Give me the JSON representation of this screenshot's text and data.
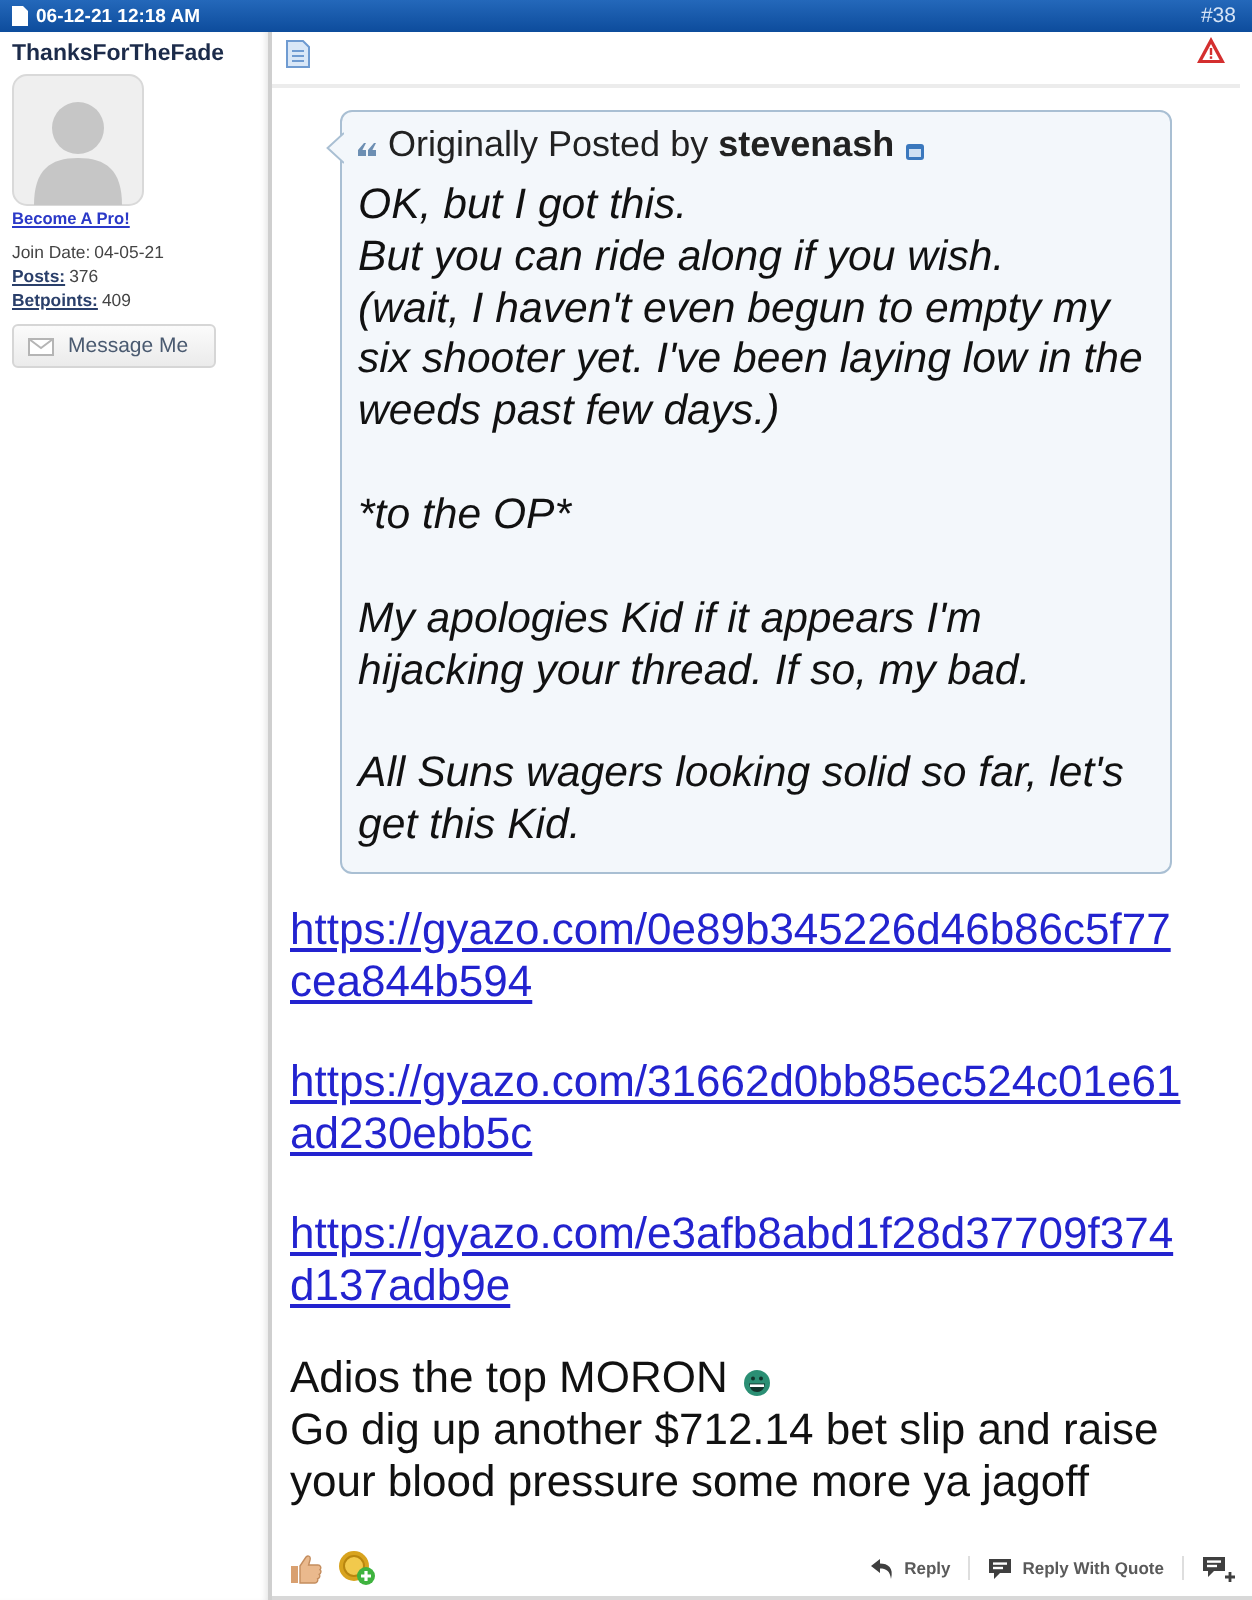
{
  "header": {
    "datetime": "06-12-21 12:18 AM",
    "post_number": "#38"
  },
  "user": {
    "name": "ThanksForTheFade",
    "promo_link": "Become A Pro!",
    "stats": [
      {
        "kind": "text",
        "label": "Join Date:",
        "value": "04-05-21"
      },
      {
        "kind": "link",
        "label": "Posts:",
        "value": "376"
      },
      {
        "kind": "link",
        "label": "Betpoints:",
        "value": "409"
      }
    ],
    "button": "Message Me"
  },
  "quote": {
    "attribution": "Originally Posted by **stevenash**",
    "paragraphs": [
      "OK, but I got this.\nBut you can ride along if you wish.\n(wait, I haven't even begun to empty my six shooter yet. I've been laying low in the weeds past few days.)",
      "*to the OP*",
      "My apologies Kid if it appears I'm hijacking your thread. If so, my bad.",
      "All Suns wagers looking solid so far, let's get this Kid."
    ]
  },
  "links": [
    "https://gyazo.com/0e89b345226d46b86c5f77cea844b594",
    "https://gyazo.com/31662d0bb85ec524c01e61ad230ebb5c",
    "https://gyazo.com/e3afb8abd1f28d37709f374d137adb9e"
  ],
  "message": {
    "lines": [
      {
        "text": "Adios the top MORON",
        "smiley": true
      },
      {
        "text": "Go dig up another $712.14 bet slip and raise your blood pressure some more ya jagoff",
        "smiley": false
      }
    ]
  },
  "footer": {
    "actions": [
      {
        "kind": "reply",
        "label": "Reply"
      },
      {
        "kind": "reply_quote",
        "label": "Reply With Quote"
      },
      {
        "kind": "multiquote"
      }
    ]
  }
}
